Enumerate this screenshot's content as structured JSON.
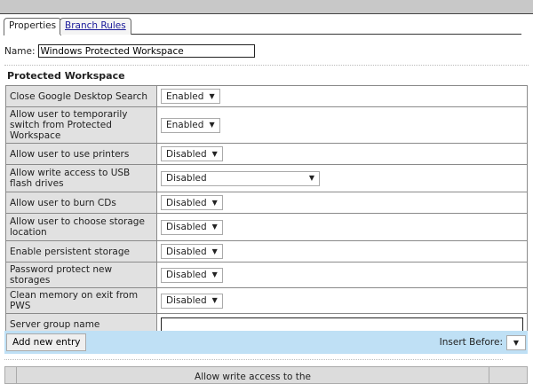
{
  "tabs": [
    {
      "label": "Properties",
      "active": true
    },
    {
      "label": "Branch Rules",
      "active": false
    }
  ],
  "name": {
    "label": "Name:",
    "value": "Windows Protected Workspace"
  },
  "section_title": "Protected Workspace",
  "rows": [
    {
      "label": "Close Google Desktop Search",
      "value": "Enabled"
    },
    {
      "label": "Allow user to temporarily switch from Protected Workspace",
      "value": "Enabled"
    },
    {
      "label": "Allow user to use printers",
      "value": "Disabled"
    },
    {
      "label": "Allow write access to USB flash drives",
      "value": "Disabled"
    },
    {
      "label": "Allow user to burn CDs",
      "value": "Disabled"
    },
    {
      "label": "Allow user to choose storage location",
      "value": "Disabled"
    },
    {
      "label": "Enable persistent storage",
      "value": "Disabled"
    },
    {
      "label": "Password protect new storages",
      "value": "Disabled"
    },
    {
      "label": "Clean memory on exit from PWS",
      "value": "Disabled"
    },
    {
      "label": "Server group name",
      "value": ""
    }
  ],
  "toolbar": {
    "add_label": "Add new entry",
    "insert_before_label": "Insert Before:",
    "insert_before_value": ""
  },
  "bottom_header": "Allow write access to the"
}
